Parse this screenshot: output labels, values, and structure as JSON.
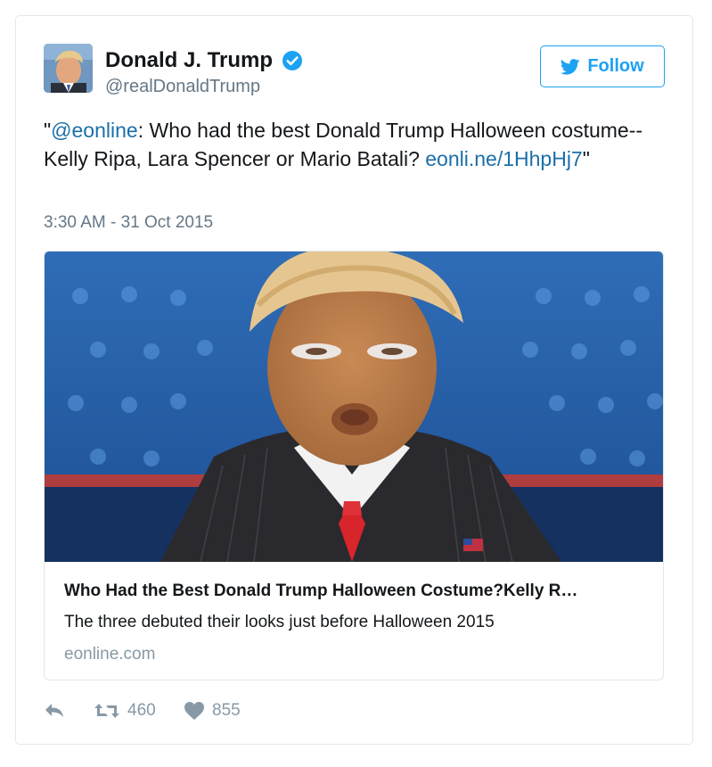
{
  "author": {
    "name": "Donald J. Trump",
    "handle": "@realDonaldTrump",
    "verified_icon": "verified-badge-icon"
  },
  "follow_button": {
    "label": "Follow",
    "icon": "twitter-bird-icon"
  },
  "tweet": {
    "open_quote": "\"",
    "mention": "@eonline",
    "body": ": Who had the best Donald Trump Halloween costume--Kelly Ripa, Lara Spencer or Mario Batali? ",
    "link": "eonli.ne/1HhpHj7",
    "close_quote": "\"",
    "timestamp": "3:30 AM - 31 Oct 2015"
  },
  "link_card": {
    "title": "Who Had the Best Donald Trump Halloween Costume?Kelly R…",
    "description": "The three debuted their looks just before Halloween 2015",
    "domain": "eonline.com"
  },
  "actions": {
    "reply_icon": "reply-icon",
    "retweet_icon": "retweet-icon",
    "retweet_count": "460",
    "like_icon": "heart-icon",
    "like_count": "855"
  },
  "colors": {
    "accent": "#1da1f2",
    "link": "#1b6fa8",
    "muted": "#657786",
    "icon": "#8899a6",
    "border": "#e1e8ed"
  }
}
